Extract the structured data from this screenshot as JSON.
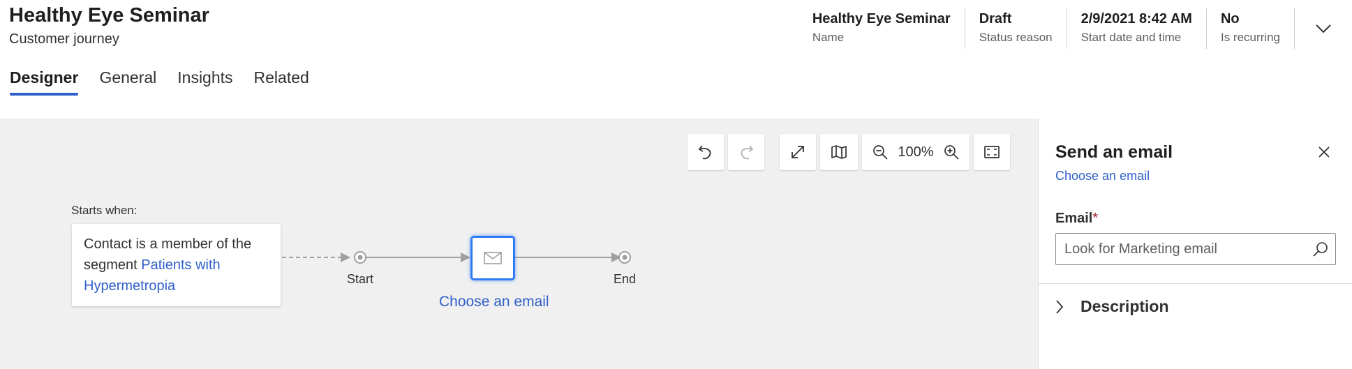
{
  "header": {
    "title": "Healthy Eye Seminar",
    "subtitle": "Customer journey",
    "fields": [
      {
        "value": "Healthy Eye Seminar",
        "label": "Name"
      },
      {
        "value": "Draft",
        "label": "Status reason"
      },
      {
        "value": "2/9/2021 8:42 AM",
        "label": "Start date and time"
      },
      {
        "value": "No",
        "label": "Is recurring"
      }
    ],
    "expand_icon": "chevron-down-icon"
  },
  "tabs": [
    {
      "label": "Designer",
      "active": true
    },
    {
      "label": "General",
      "active": false
    },
    {
      "label": "Insights",
      "active": false
    },
    {
      "label": "Related",
      "active": false
    }
  ],
  "toolbar": {
    "undo_icon": "undo-icon",
    "redo_icon": "redo-icon",
    "expand_icon": "expand-icon",
    "map_icon": "map-icon",
    "zoom_out_icon": "zoom-out-icon",
    "zoom_level": "100%",
    "zoom_in_icon": "zoom-in-icon",
    "fit_icon": "fit-to-screen-icon"
  },
  "canvas": {
    "starts_when": "Starts when:",
    "trigger_text": "Contact is a member of the segment ",
    "trigger_link": "Patients with Hypermetropia",
    "start_label": "Start",
    "end_label": "End",
    "tile_icon": "envelope-icon",
    "tile_link": "Choose an email"
  },
  "panel": {
    "title": "Send an email",
    "subtitle": "Choose an email",
    "email_label": "Email",
    "required_mark": "*",
    "email_placeholder": "Look for Marketing email",
    "description_label": "Description",
    "colors": {
      "accent": "#2f5fca",
      "required": "#a4262c"
    }
  }
}
